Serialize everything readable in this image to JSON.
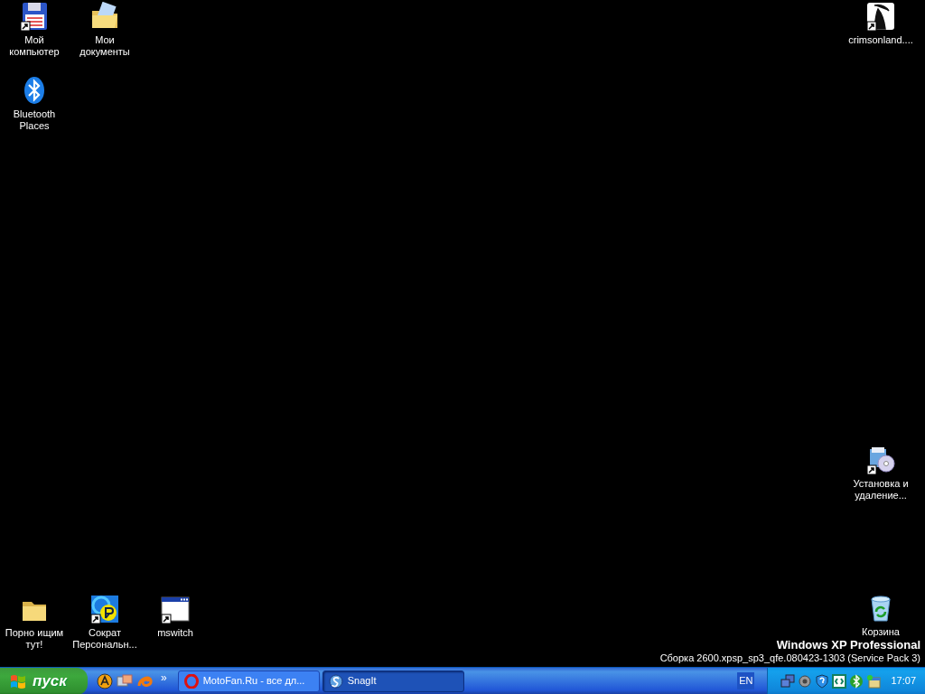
{
  "desktop_icons": [
    {
      "label": "Мой компьютер",
      "kind": "floppy",
      "shortcut": true
    },
    {
      "label": "Мои документы",
      "kind": "docs-folder",
      "shortcut": false
    },
    {
      "label": "Bluetooth Places",
      "kind": "bluetooth",
      "shortcut": false
    },
    {
      "label": "crimsonland....",
      "kind": "reaper",
      "shortcut": true
    },
    {
      "label": "Установка и удаление...",
      "kind": "installer",
      "shortcut": true
    },
    {
      "label": "Порно ищим тут!",
      "kind": "folder",
      "shortcut": false
    },
    {
      "label": "Сократ Персональн...",
      "kind": "translator",
      "shortcut": true
    },
    {
      "label": "mswitch",
      "kind": "window",
      "shortcut": true
    },
    {
      "label": "Корзина",
      "kind": "recycle",
      "shortcut": false
    }
  ],
  "os_banner": {
    "edition": "Windows XP Professional",
    "build": "Сборка 2600.xpsp_sp3_qfe.080423-1303 (Service Pack 3)"
  },
  "taskbar": {
    "start_label": "пуск",
    "quick_launch": [
      {
        "kind": "player"
      },
      {
        "kind": "messenger"
      },
      {
        "kind": "swirl"
      }
    ],
    "overflow": "»",
    "tasks": [
      {
        "label": "MotoFan.Ru - все дл...",
        "kind": "opera",
        "selected": false
      },
      {
        "label": "SnagIt",
        "kind": "snagit",
        "selected": true
      }
    ],
    "language": "EN",
    "tray_icons": [
      {
        "kind": "network"
      },
      {
        "kind": "speaker"
      },
      {
        "kind": "shield"
      },
      {
        "kind": "monitor"
      },
      {
        "kind": "bluetooth"
      },
      {
        "kind": "scheduler"
      }
    ],
    "clock": "17:07"
  }
}
